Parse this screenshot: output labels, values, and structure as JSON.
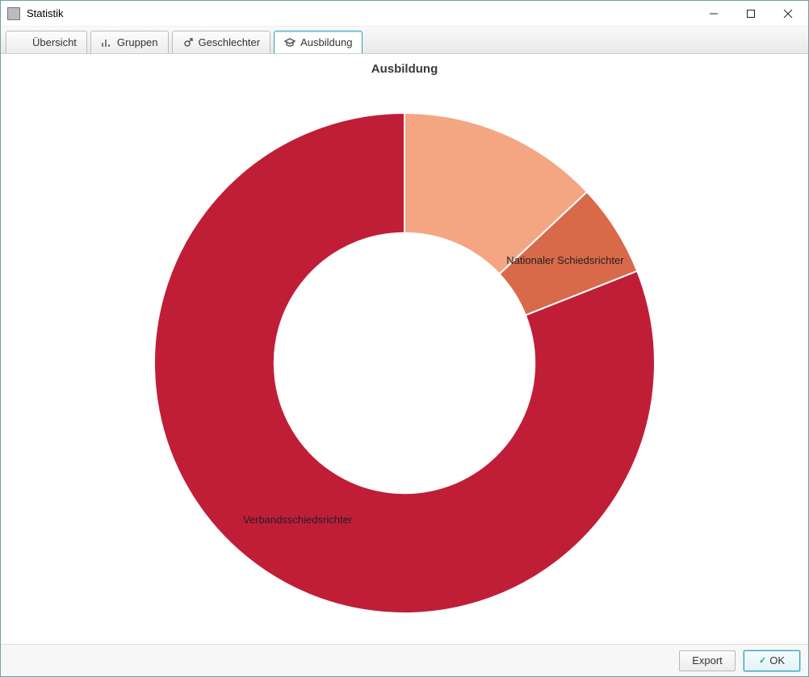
{
  "window": {
    "title": "Statistik"
  },
  "tabs": [
    {
      "label": "Übersicht",
      "icon": "overview",
      "active": false
    },
    {
      "label": "Gruppen",
      "icon": "bars",
      "active": false
    },
    {
      "label": "Geschlechter",
      "icon": "gender",
      "active": false
    },
    {
      "label": "Ausbildung",
      "icon": "cap",
      "active": true
    }
  ],
  "chart_data": {
    "type": "pie",
    "title": "Ausbildung",
    "inner_radius_ratio": 0.52,
    "series": [
      {
        "name": "",
        "value": 13,
        "color": "#f4a582",
        "label_visible": false
      },
      {
        "name": "Nationaler Schiedsrichter",
        "value": 6,
        "color": "#d86a4a",
        "label_visible": true
      },
      {
        "name": "Verbandsschiedsrichter",
        "value": 81,
        "color": "#c01e37",
        "label_visible": true
      }
    ]
  },
  "footer": {
    "export": "Export",
    "ok": "OK"
  }
}
